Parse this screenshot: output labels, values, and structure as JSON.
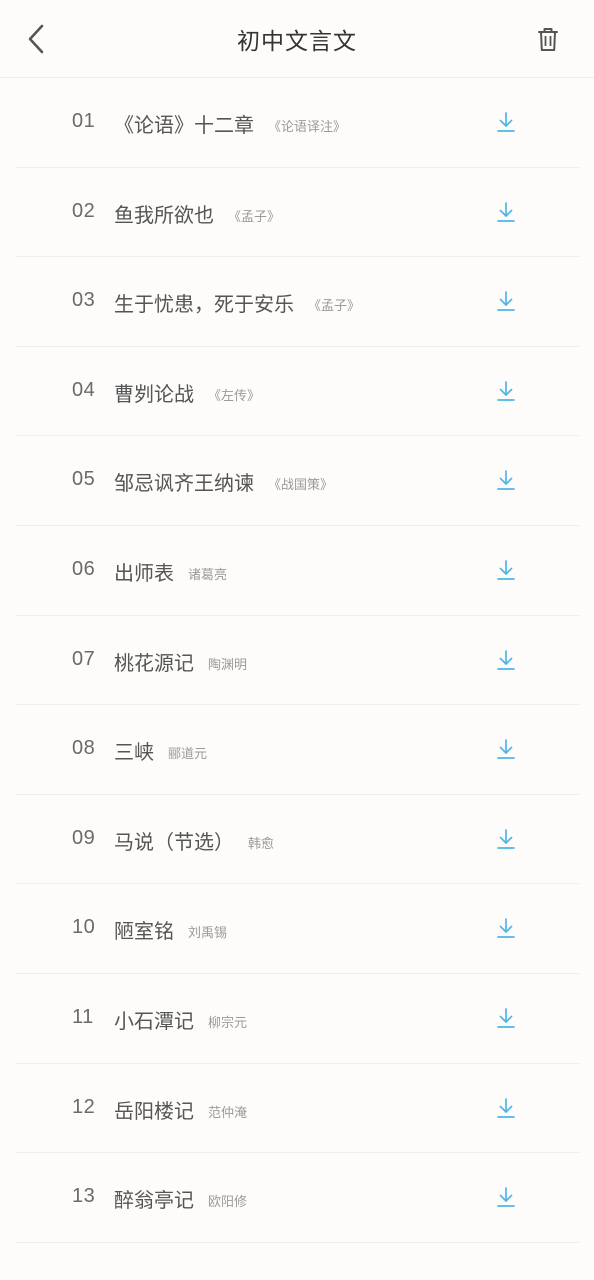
{
  "header": {
    "title": "初中文言文"
  },
  "lessons": [
    {
      "num": "01",
      "title": "《论语》十二章",
      "author": "《论语译注》"
    },
    {
      "num": "02",
      "title": "鱼我所欲也",
      "author": "《孟子》"
    },
    {
      "num": "03",
      "title": "生于忧患，死于安乐",
      "author": "《孟子》"
    },
    {
      "num": "04",
      "title": "曹刿论战",
      "author": "《左传》"
    },
    {
      "num": "05",
      "title": "邹忌讽齐王纳谏",
      "author": "《战国策》"
    },
    {
      "num": "06",
      "title": "出师表",
      "author": "诸葛亮"
    },
    {
      "num": "07",
      "title": "桃花源记",
      "author": "陶渊明"
    },
    {
      "num": "08",
      "title": "三峡",
      "author": "郦道元"
    },
    {
      "num": "09",
      "title": "马说（节选）",
      "author": "韩愈"
    },
    {
      "num": "10",
      "title": "陋室铭",
      "author": "刘禹锡"
    },
    {
      "num": "11",
      "title": "小石潭记",
      "author": "柳宗元"
    },
    {
      "num": "12",
      "title": "岳阳楼记",
      "author": "范仲淹"
    },
    {
      "num": "13",
      "title": "醉翁亭记",
      "author": "欧阳修"
    }
  ],
  "colors": {
    "accent": "#4fb6e6",
    "background": "#fdfcfa",
    "divider": "#ededeb"
  },
  "icons": {
    "back": "chevron-left-icon",
    "delete": "trash-icon",
    "download": "download-icon"
  }
}
